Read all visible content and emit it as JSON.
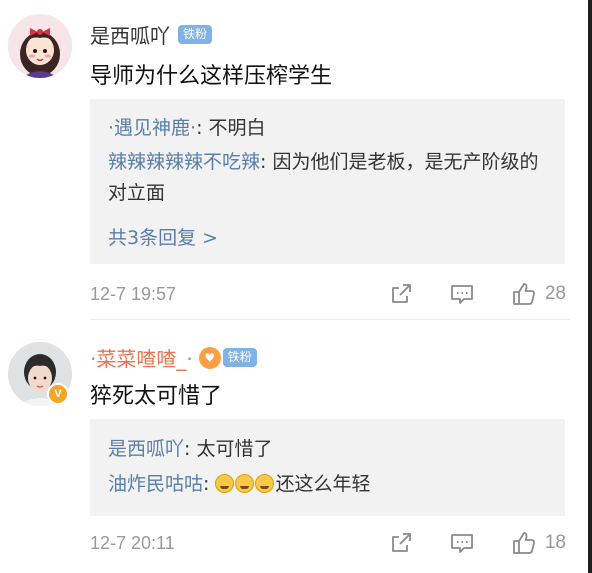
{
  "comments": [
    {
      "username": "是西呱吖",
      "fan_badge": "铁粉",
      "text": "导师为什么这样压榨学生",
      "replies": [
        {
          "name": "·遇见神鹿·",
          "text": "不明白"
        },
        {
          "name": "辣辣辣辣辣不吃辣",
          "text": "因为他们是老板，是无产阶级的对立面"
        }
      ],
      "more_replies": "共3条回复 >",
      "time": "12-7 19:57",
      "likes": "28"
    },
    {
      "username": "·菜菜喳喳_·",
      "fan_badge": "铁粉",
      "verified_badge": "V",
      "text": "猝死太可惜了",
      "replies": [
        {
          "name": "是西呱吖",
          "text": "太可惜了"
        },
        {
          "name": "油炸民咕咕",
          "text": "还这么年轻",
          "emoji_count": 3,
          "emoji": "crying-emoji"
        }
      ],
      "time": "12-7 20:11",
      "likes": "18"
    }
  ],
  "colors": {
    "link": "#5b7ea9",
    "orange_name": "#eb7350",
    "fan_badge": "#7fb2e5",
    "reply_bg": "#f2f2f2",
    "meta": "#999999"
  }
}
